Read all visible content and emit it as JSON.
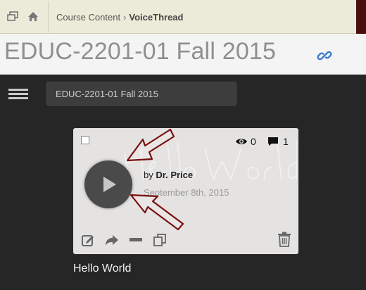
{
  "breadcrumb": {
    "parent": "Course Content",
    "separator": "›",
    "current": "VoiceThread"
  },
  "course": {
    "title": "EDUC-2201-01 Fall 2015",
    "selector_value": "EDUC-2201-01 Fall 2015"
  },
  "thread": {
    "views": "0",
    "comments": "1",
    "by_prefix": "by",
    "author": "Dr. Price",
    "date": "September 8th, 2015",
    "title": "Hello World"
  },
  "icons": {
    "window": "new-window-icon",
    "home": "home-icon",
    "link": "link-icon",
    "menu": "hamburger-menu-icon",
    "eye": "eye-icon",
    "comment": "comment-icon",
    "play": "play-icon",
    "edit": "edit-icon",
    "share": "share-icon",
    "remove": "minus-icon",
    "copy": "copy-icon",
    "trash": "trash-icon"
  },
  "colors": {
    "crumb_bar": "#ecebd9",
    "page_bg": "#262626",
    "card_bg": "#e4e3e2",
    "annotation_arrow": "#7a1010",
    "link_accent": "#3a7bd5"
  }
}
